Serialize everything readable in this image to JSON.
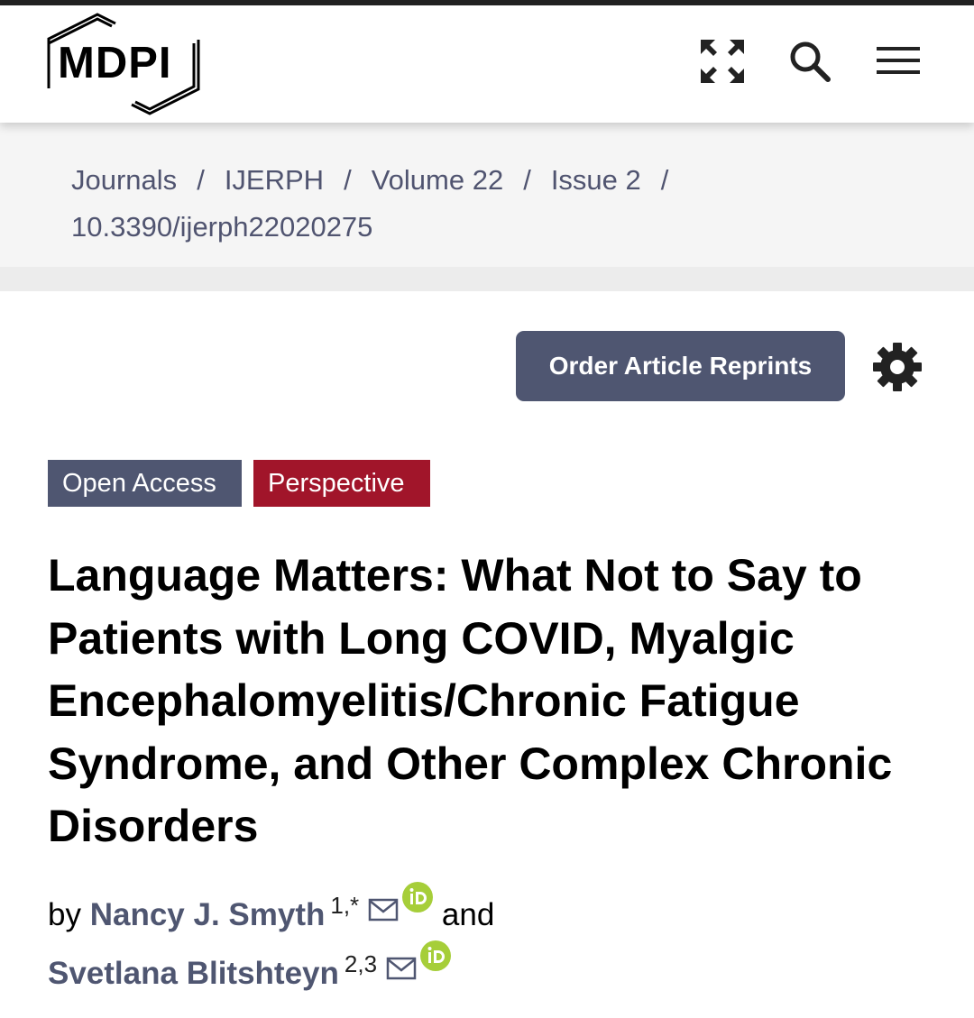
{
  "header": {
    "logo_text": "MDPI",
    "icons": [
      "expand-icon",
      "search-icon",
      "menu-icon"
    ]
  },
  "breadcrumb": {
    "items": [
      "Journals",
      "IJERPH",
      "Volume 22",
      "Issue 2",
      "10.3390/ijerph22020275"
    ],
    "separator": "/"
  },
  "actions": {
    "reprints_label": "Order Article Reprints",
    "settings_icon": "gear-icon"
  },
  "badges": {
    "open_access": "Open Access",
    "article_type": "Perspective"
  },
  "article": {
    "title": "Language Matters: What Not to Say to Patients with Long COVID, Myalgic Encephalomyelitis/Chronic Fatigue Syndrome, and Other Complex Chronic Disorders",
    "by": "by",
    "and": "and",
    "authors": [
      {
        "name": "Nancy J. Smyth",
        "affiliation": "1,*"
      },
      {
        "name": "Svetlana Blitshteyn",
        "affiliation": "2,3"
      }
    ]
  },
  "colors": {
    "accent": "#4f5671",
    "perspective_badge": "#a1152a",
    "orcid": "#a6ce39"
  }
}
